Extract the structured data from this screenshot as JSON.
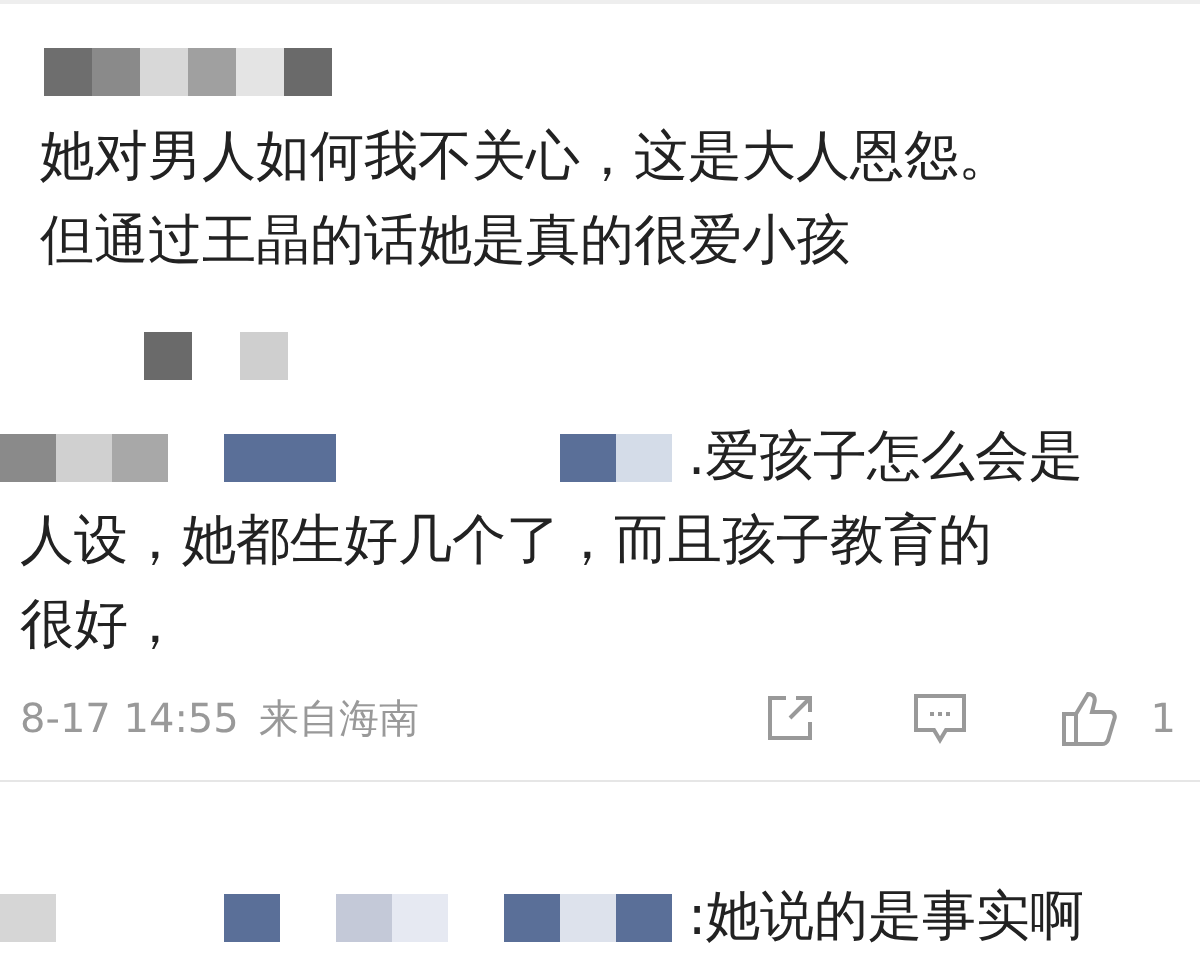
{
  "comment": {
    "lines": [
      "她对男人如何我不关心，这是大人恩怨。",
      "但通过王晶的话她是真的很爱小孩"
    ]
  },
  "reply": {
    "first_line_tail": ".爱孩子怎么会是",
    "lines": [
      "人设，她都生好几个了，而且孩子教育的",
      "很好，"
    ],
    "time": "8-17 14:55",
    "source": "来自海南",
    "like_count": "1"
  },
  "next_reply": {
    "first_line_tail": ":她说的是事实啊"
  }
}
